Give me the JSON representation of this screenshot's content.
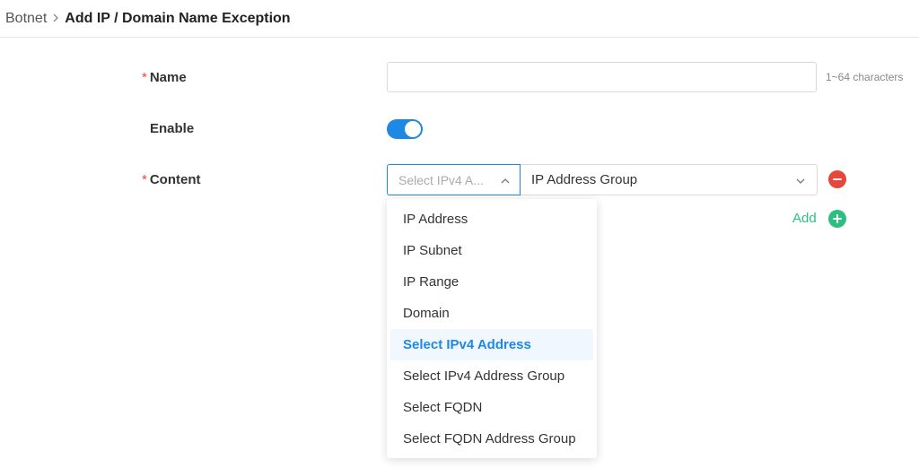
{
  "breadcrumb": {
    "parent": "Botnet",
    "current": "Add IP / Domain Name Exception"
  },
  "form": {
    "name": {
      "label": "Name",
      "required_mark": "*",
      "value": "",
      "hint": "1~64 characters"
    },
    "enable": {
      "label": "Enable",
      "checked": true
    },
    "content": {
      "label": "Content",
      "required_mark": "*",
      "type_placeholder": "Select IPv4 A...",
      "value": "IP Address Group",
      "add_label": "Add"
    }
  },
  "dropdown": {
    "options": [
      "IP Address",
      "IP Subnet",
      "IP Range",
      "Domain",
      "Select IPv4 Address",
      "Select IPv4 Address Group",
      "Select FQDN",
      "Select FQDN Address Group"
    ],
    "selected": "Select IPv4 Address"
  },
  "colors": {
    "accent": "#1e88e5",
    "required": "#e8463b",
    "add": "#2cbf7f",
    "remove": "#e8463b"
  },
  "icons": {
    "breadcrumb_separator": "chevron-right-icon",
    "type_select": "chevron-up-icon",
    "value_select": "chevron-down-icon",
    "remove": "minus-circle-icon",
    "add": "plus-circle-icon"
  }
}
